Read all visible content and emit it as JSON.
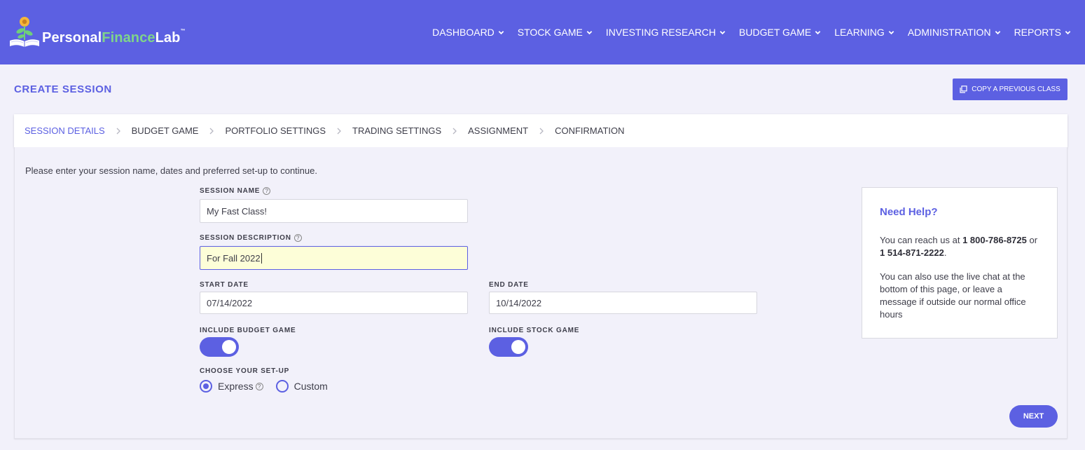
{
  "brand": {
    "name_part1": "Personal",
    "name_part2": "Finance",
    "name_part3": "Lab",
    "trademark": "™"
  },
  "nav": {
    "items": [
      {
        "label": "DASHBOARD"
      },
      {
        "label": "STOCK GAME"
      },
      {
        "label": "INVESTING RESEARCH"
      },
      {
        "label": "BUDGET GAME"
      },
      {
        "label": "LEARNING"
      },
      {
        "label": "ADMINISTRATION"
      },
      {
        "label": "REPORTS"
      }
    ]
  },
  "page": {
    "title": "CREATE SESSION",
    "copy_button": "COPY A PREVIOUS CLASS"
  },
  "steps": [
    {
      "label": "SESSION DETAILS",
      "active": true
    },
    {
      "label": "BUDGET GAME"
    },
    {
      "label": "PORTFOLIO SETTINGS"
    },
    {
      "label": "TRADING SETTINGS"
    },
    {
      "label": "ASSIGNMENT"
    },
    {
      "label": "CONFIRMATION"
    }
  ],
  "form": {
    "intro": "Please enter your session name, dates and preferred set-up to continue.",
    "session_name_label": "SESSION NAME",
    "session_name_value": "My Fast Class!",
    "session_description_label": "SESSION DESCRIPTION",
    "session_description_value": "For Fall 2022",
    "start_date_label": "START DATE",
    "start_date_value": "07/14/2022",
    "end_date_label": "END DATE",
    "end_date_value": "10/14/2022",
    "include_budget_label": "INCLUDE BUDGET GAME",
    "include_budget_on": true,
    "include_stock_label": "INCLUDE STOCK GAME",
    "include_stock_on": true,
    "setup_label": "CHOOSE YOUR SET-UP",
    "setup_options": [
      {
        "label": "Express",
        "selected": true
      },
      {
        "label": "Custom",
        "selected": false
      }
    ],
    "next_button": "NEXT"
  },
  "help": {
    "title": "Need Help?",
    "reach_prefix": "You can reach us at ",
    "phone1": "1 800-786-8725",
    "or_text": " or ",
    "phone2": "1 514-871-2222",
    "period": ".",
    "chat_text": "You can also use the live chat at the bottom of this page, or leave a message if outside our normal office hours"
  },
  "colors": {
    "accent": "#5c60e2",
    "logo_green": "#7fd48a",
    "background": "#f2f1fa",
    "focused_input": "#fdfed8"
  },
  "icons": {
    "logo": "flower-book-icon",
    "nav_chevron": "chevron-down-icon",
    "copy": "copy-icon",
    "step_separator": "chevron-right-icon",
    "help": "question-circle-icon"
  }
}
